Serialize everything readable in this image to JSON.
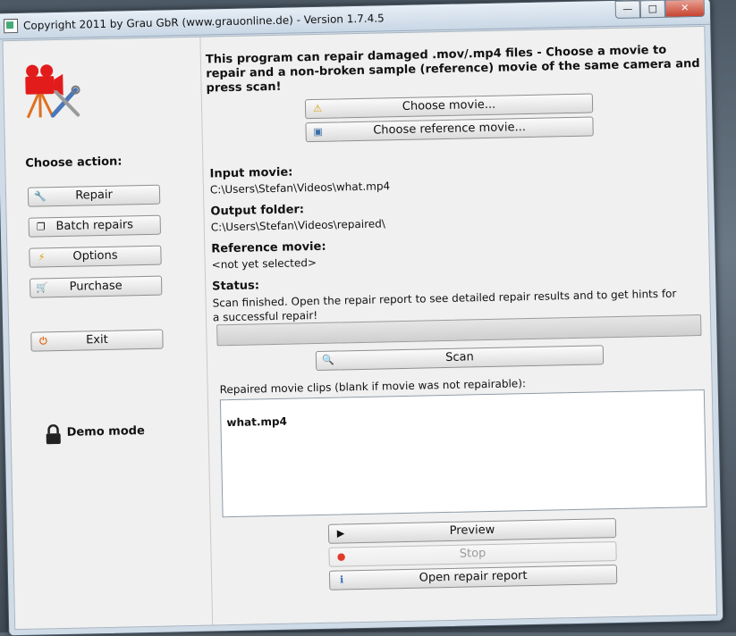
{
  "window": {
    "title": "Copyright 2011 by Grau GbR (www.grauonline.de) - Version 1.7.4.5",
    "controls": {
      "minimize": "—",
      "maximize": "□",
      "close": "✕"
    }
  },
  "sidebar": {
    "choose_action": "Choose action:",
    "buttons": [
      {
        "label": "Repair",
        "icon": "wrench-icon"
      },
      {
        "label": "Batch repairs",
        "icon": "batch-icon"
      },
      {
        "label": "Options",
        "icon": "lightning-icon"
      },
      {
        "label": "Purchase",
        "icon": "cart-icon"
      }
    ],
    "exit": {
      "label": "Exit",
      "icon": "power-icon"
    },
    "demo_mode": "Demo mode"
  },
  "main": {
    "intro": "This program can repair damaged .mov/.mp4 files - Choose a movie to repair and a non-broken sample (reference) movie of the same camera and press scan!",
    "choose_movie": "Choose movie...",
    "choose_reference": "Choose reference movie...",
    "input_movie": {
      "label": "Input movie:",
      "value": "C:\\Users\\Stefan\\Videos\\what.mp4"
    },
    "output_folder": {
      "label": "Output folder:",
      "value": "C:\\Users\\Stefan\\Videos\\repaired\\"
    },
    "reference_movie": {
      "label": "Reference movie:",
      "value": "<not yet selected>"
    },
    "status": {
      "label": "Status:",
      "value": "Scan finished. Open the repair report to see detailed repair results and to get hints for a successful repair!"
    },
    "progress": 0,
    "scan": "Scan",
    "clips_caption": "Repaired movie clips (blank if movie was not repairable):",
    "clips": [
      "what.mp4"
    ],
    "preview": "Preview",
    "stop": "Stop",
    "open_report": "Open repair report"
  },
  "colors": {
    "window_frame": "#cfdce8",
    "client_bg": "#f0f0f0",
    "close_button": "#c7432f"
  }
}
